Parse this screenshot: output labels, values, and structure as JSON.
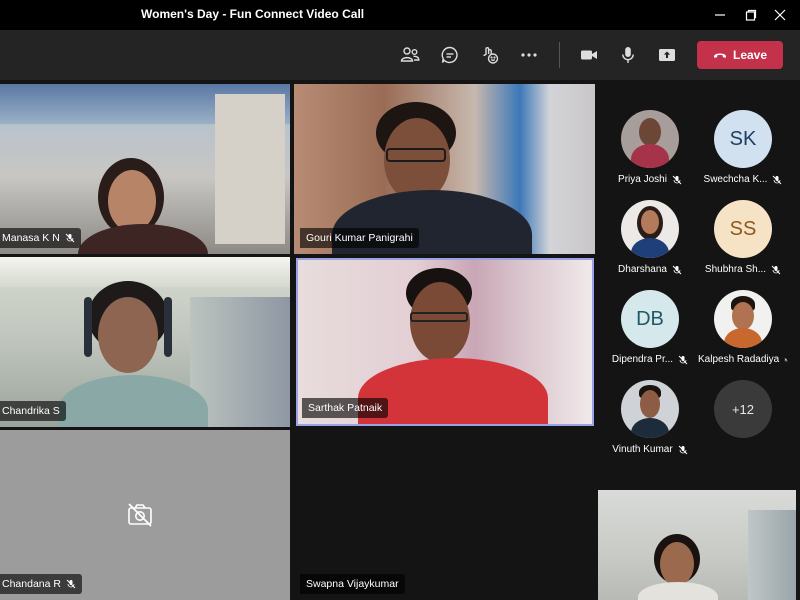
{
  "window": {
    "title": "Women's Day - Fun Connect Video Call"
  },
  "toolbar": {
    "leave_label": "Leave"
  },
  "tiles": [
    {
      "name": "Manasa K N",
      "muted": true
    },
    {
      "name": "Gouri Kumar Panigrahi",
      "muted": false
    },
    {
      "name": "Chandrika S",
      "muted": false
    },
    {
      "name": "Sarthak Patnaik",
      "muted": false
    },
    {
      "name": "Chandana R",
      "muted": true
    },
    {
      "name": "Swapna Vijaykumar",
      "muted": false
    }
  ],
  "roster": [
    {
      "name": "Priya Joshi",
      "initials": "",
      "muted": true
    },
    {
      "name": "Swechcha K...",
      "initials": "SK",
      "muted": true
    },
    {
      "name": "Dharshana",
      "initials": "",
      "muted": true
    },
    {
      "name": "Shubhra Sh...",
      "initials": "SS",
      "muted": true
    },
    {
      "name": "Dipendra Pr...",
      "initials": "DB",
      "muted": true
    },
    {
      "name": "Kalpesh Radadiya",
      "initials": "",
      "muted": true
    },
    {
      "name": "Vinuth Kumar",
      "initials": "",
      "muted": true
    }
  ],
  "roster_more": "+12",
  "colors": {
    "leave": "#c4314b",
    "active_speaker_border": "#9aa3e8",
    "sk_bg": "#d2e1ef",
    "ss_bg": "#f6e3c6",
    "db_bg": "#d5e8ec"
  }
}
